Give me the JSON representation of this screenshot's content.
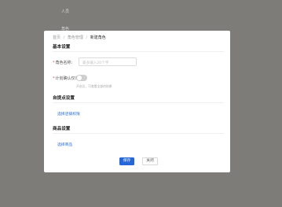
{
  "background_menu": {
    "items": [
      "人员",
      "角色"
    ]
  },
  "breadcrumb": {
    "home": "首页",
    "parent": "角色管理",
    "current": "新建角色",
    "separator": "/"
  },
  "basic_section": {
    "title": "基本设置",
    "role_name_label": "角色名称:",
    "role_name_placeholder": "最多输入20个字",
    "plan_confirm_label": "计划确认仅单:",
    "plan_confirm_hint": "开启后，可查看全部的结果"
  },
  "pickup_section": {
    "title": "自提点设置",
    "link": "选择店铺权限"
  },
  "product_section": {
    "title": "商品设置",
    "link": "选择商品"
  },
  "footer": {
    "save_label": "保存",
    "close_label": "关闭"
  },
  "colors": {
    "primary": "#2566d8",
    "overlay": "#7d7c79",
    "required": "#e34d4d",
    "toggle_off": "#cfcfcf"
  }
}
